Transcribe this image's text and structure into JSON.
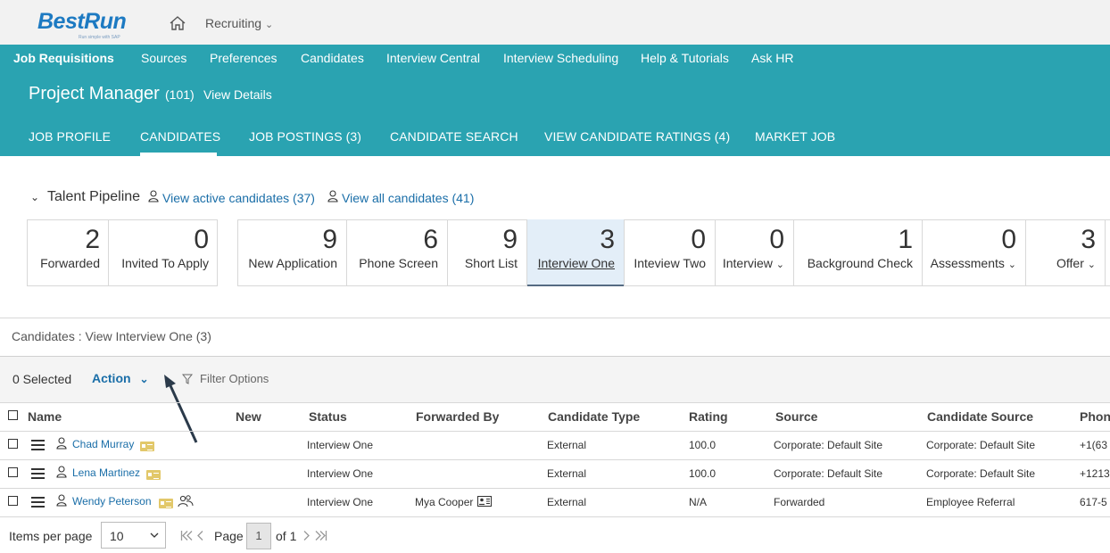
{
  "shell": {
    "brand": "BestRun",
    "tagline": "Run simple with SAP",
    "module": "Recruiting"
  },
  "topnav": [
    "Job Requisitions",
    "Sources",
    "Preferences",
    "Candidates",
    "Interview Central",
    "Interview Scheduling",
    "Help & Tutorials",
    "Ask HR"
  ],
  "job": {
    "title": "Project Manager",
    "number": "(101)",
    "details_link": "View Details"
  },
  "tabs": [
    "JOB PROFILE",
    "CANDIDATES",
    "JOB POSTINGS (3)",
    "CANDIDATE SEARCH",
    "VIEW CANDIDATE RATINGS (4)",
    "MARKET JOB"
  ],
  "pipeline": {
    "title": "Talent Pipeline",
    "active_link": "View active candidates (37)",
    "all_link": "View all candidates (41)",
    "group1": [
      {
        "count": "2",
        "label": "Forwarded"
      },
      {
        "count": "0",
        "label": "Invited To Apply"
      }
    ],
    "group2": [
      {
        "count": "9",
        "label": "New Application"
      },
      {
        "count": "6",
        "label": "Phone Screen"
      },
      {
        "count": "9",
        "label": "Short List"
      },
      {
        "count": "3",
        "label": "Interview One"
      },
      {
        "count": "0",
        "label": "Inteview Two"
      },
      {
        "count": "0",
        "label": "Interview"
      },
      {
        "count": "1",
        "label": "Background Check"
      },
      {
        "count": "0",
        "label": "Assessments"
      },
      {
        "count": "3",
        "label": "Offer"
      }
    ]
  },
  "candidates": {
    "heading": "Candidates : View Interview One (3)",
    "selected": "0 Selected",
    "action": "Action",
    "filter": "Filter Options",
    "columns": [
      "Name",
      "New",
      "Status",
      "Forwarded By",
      "Candidate Type",
      "Rating",
      "Source",
      "Candidate Source",
      "Phon"
    ],
    "rows": [
      {
        "name": "Chad Murray",
        "status": "Interview One",
        "forwarded_by": "",
        "type": "External",
        "rating": "100.0",
        "source": "Corporate: Default Site",
        "cand_source": "Corporate: Default Site",
        "phone": "+1(63"
      },
      {
        "name": "Lena Martinez",
        "status": "Interview One",
        "forwarded_by": "",
        "type": "External",
        "rating": "100.0",
        "source": "Corporate: Default Site",
        "cand_source": "Corporate: Default Site",
        "phone": "+1213"
      },
      {
        "name": "Wendy Peterson",
        "status": "Interview One",
        "forwarded_by": "Mya Cooper",
        "type": "External",
        "rating": "N/A",
        "source": "Forwarded",
        "cand_source": "Employee Referral",
        "phone": "617-5"
      }
    ]
  },
  "pagination": {
    "items_label": "Items per page",
    "items_value": "10",
    "page_label": "Page",
    "page_value": "1",
    "of_label": "of 1"
  },
  "colors": {
    "teal": "#2aa3b1",
    "link": "#1a6ea8",
    "badge": "#e2c86a"
  }
}
